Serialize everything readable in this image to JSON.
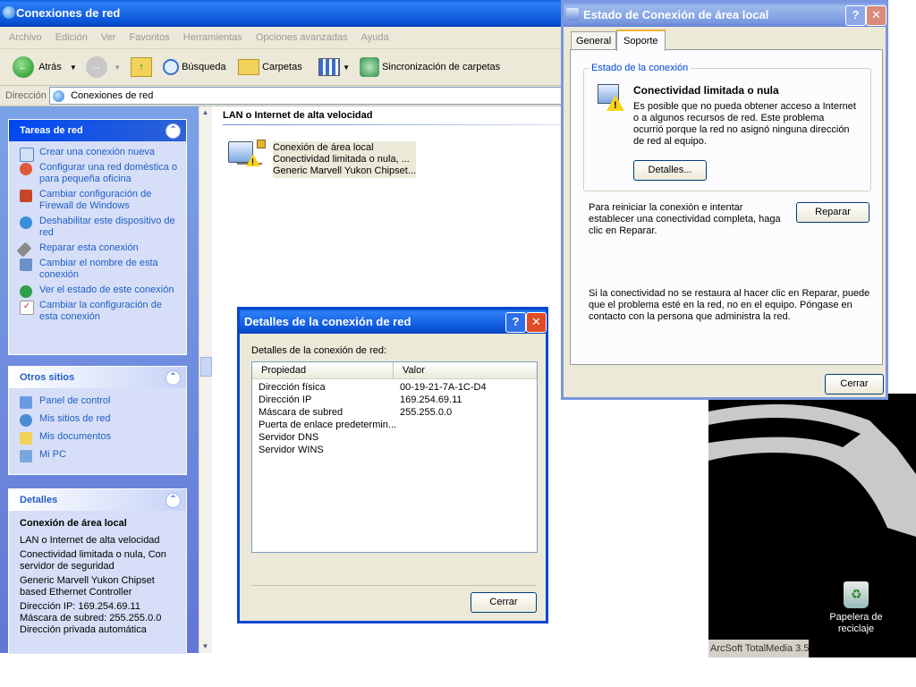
{
  "explorer": {
    "title": "Conexiones de red",
    "menu": [
      "Archivo",
      "Edición",
      "Ver",
      "Favoritos",
      "Herramientas",
      "Opciones avanzadas",
      "Ayuda"
    ],
    "toolbar": {
      "back": "Atrás",
      "search": "Búsqueda",
      "folders": "Carpetas",
      "sync": "Sincronización de carpetas"
    },
    "address": {
      "label": "Dirección",
      "value": "Conexiones de red"
    }
  },
  "sidebar": {
    "network_tasks": {
      "title": "Tareas de red",
      "items": [
        "Crear una conexión nueva",
        "Configurar una red doméstica o para pequeña oficina",
        "Cambiar configuración de Firewall de Windows",
        "Deshabilitar este dispositivo de red",
        "Reparar esta conexión",
        "Cambiar el nombre de esta conexión",
        "Ver el estado de este conexión",
        "Cambiar la configuración de esta conexión"
      ]
    },
    "other_places": {
      "title": "Otros sitios",
      "items": [
        "Panel de control",
        "Mis sitios de red",
        "Mis documentos",
        "Mi PC"
      ]
    },
    "details": {
      "title": "Detalles",
      "name": "Conexión de área local",
      "lines": [
        "LAN o Internet de alta velocidad",
        "Conectividad limitada o nula, Con servidor de seguridad",
        "Generic Marvell Yukon Chipset based Ethernet Controller",
        "Dirección IP: 169.254.69.11\nMáscara de subred: 255.255.0.0\nDirección privada automática"
      ]
    }
  },
  "main": {
    "group_header": "LAN o Internet de alta velocidad",
    "connection": {
      "name": "Conexión de área local",
      "status": "Conectividad limitada o nula, ...",
      "device": "Generic Marvell Yukon Chipset..."
    }
  },
  "details_dialog": {
    "title": "Detalles de la conexión de red",
    "label": "Detalles de la conexión de red:",
    "columns": [
      "Propiedad",
      "Valor"
    ],
    "rows": [
      [
        "Dirección física",
        "00-19-21-7A-1C-D4"
      ],
      [
        "Dirección IP",
        "169.254.69.11"
      ],
      [
        "Máscara de subred",
        "255.255.0.0"
      ],
      [
        "Puerta de enlace predetermin...",
        ""
      ],
      [
        "Servidor DNS",
        ""
      ],
      [
        "Servidor WINS",
        ""
      ]
    ],
    "close": "Cerrar"
  },
  "status_dialog": {
    "title": "Estado de Conexión de área local",
    "tabs": [
      "General",
      "Soporte"
    ],
    "group_title": "Estado de la conexión",
    "heading": "Conectividad limitada o nula",
    "message": "Es posible que no pueda obtener acceso a Internet o a algunos recursos de red. Este problema ocurrió porque la red no asignó ninguna dirección de red al equipo.",
    "details_btn": "Detalles...",
    "repair_text": "Para reiniciar la conexión e intentar establecer una conectividad completa, haga clic en Reparar.",
    "repair_btn": "Reparar",
    "footer_text": "Si la conectividad no se restaura al hacer clic en Reparar, puede que el problema esté en la red, no en el equipo. Póngase en contacto con la persona que administra la red.",
    "close": "Cerrar"
  },
  "desktop": {
    "recycle_bin": "Papelera de reciclaje",
    "taskbar_text": "ArcSoft TotalMedia 3.5"
  }
}
